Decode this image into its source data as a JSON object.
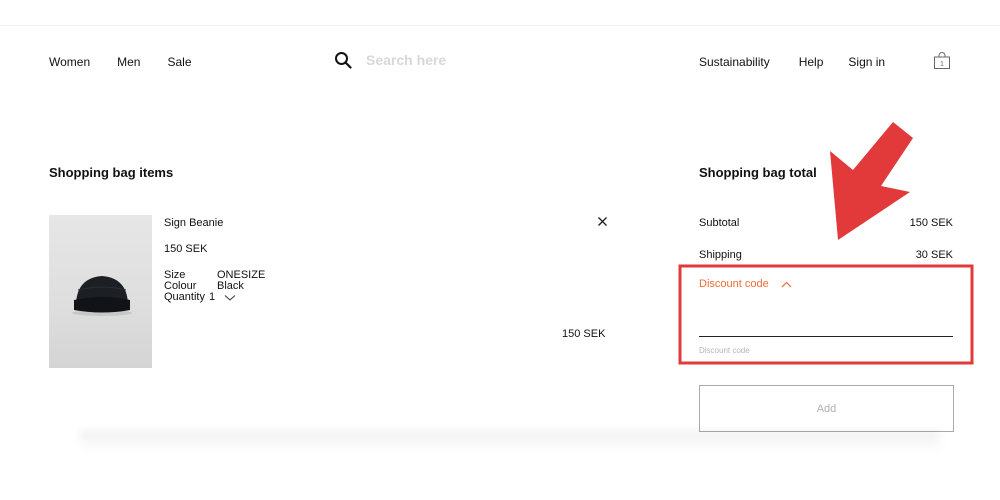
{
  "header": {
    "nav_left": [
      "Women",
      "Men",
      "Sale"
    ],
    "search": {
      "placeholder": "Search here",
      "icon": "search-icon"
    },
    "nav_right": [
      "Sustainability",
      "Help",
      "Sign in"
    ],
    "bag_icon": "shopping-bag-icon",
    "bag_count": "1"
  },
  "items_section": {
    "title": "Shopping bag items",
    "items": [
      {
        "name": "Sign Beanie",
        "price": "150 SEK",
        "attributes": [
          {
            "label": "Size",
            "value": "ONESIZE"
          },
          {
            "label": "Colour",
            "value": "Black"
          }
        ],
        "quantity_label": "Quantity",
        "quantity": "1",
        "line_total": "150 SEK"
      }
    ]
  },
  "summary": {
    "title": "Shopping bag total",
    "subtotal_label": "Subtotal",
    "subtotal_value": "150 SEK",
    "shipping_label": "Shipping",
    "shipping_value": "30 SEK",
    "discount_toggle_label": "Discount code",
    "discount_field_caption": "Discount code",
    "discount_field_value": "",
    "add_button_label": "Add"
  },
  "colors": {
    "accent": "#f06a33",
    "annotation_red": "#e23a3a"
  }
}
